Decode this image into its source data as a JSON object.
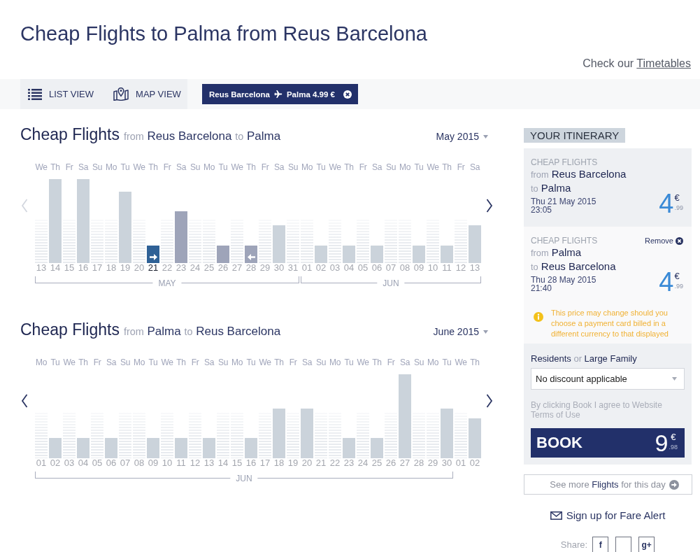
{
  "page": {
    "title": "Cheap Flights to Palma from Reus Barcelona",
    "timetables": {
      "prefix": "Check our",
      "link": "Timetables"
    }
  },
  "toolbar": {
    "views": [
      {
        "kind": "list",
        "label": "LIST VIEW"
      },
      {
        "kind": "map",
        "label": "MAP VIEW"
      }
    ],
    "route_chip": {
      "origin": "Reus Barcelona",
      "destination": "Palma",
      "price": "4.99 €"
    }
  },
  "charts": [
    {
      "title": "Cheap Flights",
      "route": "*from* Reus Barcelona *to* Palma",
      "month_select": "May 2015",
      "prev_arrow": {
        "disabled": true
      },
      "next_arrow": {
        "disabled": false
      },
      "months": [
        {
          "label": "MAY",
          "days": [
            {
              "weekday": "We",
              "date": "13",
              "kind": "empty",
              "selected": false
            },
            {
              "weekday": "Th",
              "date": "14",
              "kind": "fare",
              "selected": false
            },
            {
              "weekday": "Fr",
              "date": "15",
              "kind": "empty",
              "selected": false
            },
            {
              "weekday": "Sa",
              "date": "16",
              "kind": "fare",
              "selected": false
            },
            {
              "weekday": "Su",
              "date": "17",
              "kind": "empty",
              "selected": false
            },
            {
              "weekday": "Mo",
              "date": "18",
              "kind": "empty",
              "selected": false
            },
            {
              "weekday": "Tu",
              "date": "19",
              "kind": "fare",
              "selected": false
            },
            {
              "weekday": "We",
              "date": "20",
              "kind": "empty",
              "selected": false
            },
            {
              "weekday": "Th",
              "date": "21",
              "kind": "outbound",
              "selected": true
            },
            {
              "weekday": "Fr",
              "date": "22",
              "kind": "empty",
              "selected": false
            },
            {
              "weekday": "Sa",
              "date": "23",
              "kind": "in_range",
              "selected": false
            },
            {
              "weekday": "Su",
              "date": "24",
              "kind": "empty",
              "selected": false
            },
            {
              "weekday": "Mo",
              "date": "25",
              "kind": "empty",
              "selected": false
            },
            {
              "weekday": "Tu",
              "date": "26",
              "kind": "in_range",
              "selected": false
            },
            {
              "weekday": "We",
              "date": "27",
              "kind": "empty",
              "selected": false
            },
            {
              "weekday": "Th",
              "date": "28",
              "kind": "return",
              "selected": false
            },
            {
              "weekday": "Fr",
              "date": "29",
              "kind": "empty",
              "selected": false
            },
            {
              "weekday": "Sa",
              "date": "30",
              "kind": "fare",
              "selected": false
            },
            {
              "weekday": "Su",
              "date": "31",
              "kind": "empty",
              "selected": false
            }
          ]
        },
        {
          "label": "JUN",
          "days": [
            {
              "weekday": "Mo",
              "date": "01",
              "kind": "empty",
              "selected": false
            },
            {
              "weekday": "Tu",
              "date": "02",
              "kind": "fare",
              "selected": false
            },
            {
              "weekday": "We",
              "date": "03",
              "kind": "empty",
              "selected": false
            },
            {
              "weekday": "Th",
              "date": "04",
              "kind": "fare",
              "selected": false
            },
            {
              "weekday": "Fr",
              "date": "05",
              "kind": "empty",
              "selected": false
            },
            {
              "weekday": "Sa",
              "date": "06",
              "kind": "fare",
              "selected": false
            },
            {
              "weekday": "Su",
              "date": "07",
              "kind": "empty",
              "selected": false
            },
            {
              "weekday": "Mo",
              "date": "08",
              "kind": "empty",
              "selected": false
            },
            {
              "weekday": "Tu",
              "date": "09",
              "kind": "fare",
              "selected": false
            },
            {
              "weekday": "We",
              "date": "10",
              "kind": "empty",
              "selected": false
            },
            {
              "weekday": "Th",
              "date": "11",
              "kind": "fare",
              "selected": false
            },
            {
              "weekday": "Fr",
              "date": "12",
              "kind": "empty",
              "selected": false
            },
            {
              "weekday": "Sa",
              "date": "13",
              "kind": "fare",
              "selected": false
            }
          ]
        }
      ]
    },
    {
      "title": "Cheap Flights",
      "route": "*from* Palma *to* Reus Barcelona",
      "month_select": "June 2015",
      "prev_arrow": {
        "disabled": false
      },
      "next_arrow": {
        "disabled": false
      },
      "months": [
        {
          "label": "JUN",
          "days": [
            {
              "weekday": "Mo",
              "date": "01",
              "kind": "empty",
              "selected": false
            },
            {
              "weekday": "Tu",
              "date": "02",
              "kind": "fare",
              "selected": false
            },
            {
              "weekday": "We",
              "date": "03",
              "kind": "empty",
              "selected": false
            },
            {
              "weekday": "Th",
              "date": "04",
              "kind": "fare",
              "selected": false
            },
            {
              "weekday": "Fr",
              "date": "05",
              "kind": "empty",
              "selected": false
            },
            {
              "weekday": "Sa",
              "date": "06",
              "kind": "fare",
              "selected": false
            },
            {
              "weekday": "Su",
              "date": "07",
              "kind": "empty",
              "selected": false
            },
            {
              "weekday": "Mo",
              "date": "08",
              "kind": "empty",
              "selected": false
            },
            {
              "weekday": "Tu",
              "date": "09",
              "kind": "fare",
              "selected": false
            },
            {
              "weekday": "We",
              "date": "10",
              "kind": "empty",
              "selected": false
            },
            {
              "weekday": "Th",
              "date": "11",
              "kind": "fare",
              "selected": false
            },
            {
              "weekday": "Fr",
              "date": "12",
              "kind": "empty",
              "selected": false
            },
            {
              "weekday": "Sa",
              "date": "13",
              "kind": "fare",
              "selected": false
            },
            {
              "weekday": "Su",
              "date": "14",
              "kind": "empty",
              "selected": false
            },
            {
              "weekday": "Mo",
              "date": "15",
              "kind": "empty",
              "selected": false
            },
            {
              "weekday": "Tu",
              "date": "16",
              "kind": "fare",
              "selected": false
            },
            {
              "weekday": "We",
              "date": "17",
              "kind": "empty",
              "selected": false
            },
            {
              "weekday": "Th",
              "date": "18",
              "kind": "fare",
              "selected": false
            },
            {
              "weekday": "Fr",
              "date": "19",
              "kind": "empty",
              "selected": false
            },
            {
              "weekday": "Sa",
              "date": "20",
              "kind": "fare",
              "selected": false
            },
            {
              "weekday": "Su",
              "date": "21",
              "kind": "empty",
              "selected": false
            },
            {
              "weekday": "Mo",
              "date": "22",
              "kind": "empty",
              "selected": false
            },
            {
              "weekday": "Tu",
              "date": "23",
              "kind": "fare",
              "selected": false
            },
            {
              "weekday": "We",
              "date": "24",
              "kind": "empty",
              "selected": false
            },
            {
              "weekday": "Th",
              "date": "25",
              "kind": "fare",
              "selected": false
            },
            {
              "weekday": "Fr",
              "date": "26",
              "kind": "empty",
              "selected": false
            },
            {
              "weekday": "Sa",
              "date": "27",
              "kind": "fare",
              "selected": false
            },
            {
              "weekday": "Su",
              "date": "28",
              "kind": "empty",
              "selected": false
            },
            {
              "weekday": "Mo",
              "date": "29",
              "kind": "empty",
              "selected": false
            },
            {
              "weekday": "Tu",
              "date": "30",
              "kind": "fare",
              "selected": false
            }
          ]
        },
        {
          "days": [
            {
              "weekday": "We",
              "date": "01",
              "kind": "empty",
              "selected": false
            },
            {
              "weekday": "Th",
              "date": "02",
              "kind": "fare",
              "selected": false
            }
          ]
        }
      ]
    }
  ],
  "itinerary": {
    "heading": "YOUR ITINERARY",
    "flights": [
      {
        "label": "CHEAP FLIGHTS",
        "from": "*from* Reus Barcelona",
        "to": "*to* Palma",
        "date": "Thu 21 May 2015",
        "time": "23:05",
        "price": {
          "whole": "4",
          "currency": "€",
          "cents": ".99"
        }
      },
      {
        "label": "CHEAP FLIGHTS",
        "remove": "Remove",
        "from": "*from* Palma",
        "to": "*to* Reus Barcelona",
        "date": "Thu 28 May 2015",
        "time": "21:40",
        "price": {
          "whole": "4",
          "currency": "€",
          "cents": ".99"
        }
      }
    ],
    "notice": "This price may change should you choose a payment card billed in a different currency to that displayed",
    "discount": {
      "label": "Residents *or* Large Family",
      "value": "No discount applicable"
    },
    "terms": "By clicking Book I agree to Website Terms of Use",
    "book": {
      "label": "BOOK",
      "price": {
        "whole": "9",
        "currency": "€",
        "cents": ".98"
      }
    }
  },
  "see_more": "See more **Flights** for this day",
  "fare_alert": "Sign up for Fare Alert",
  "share": {
    "label": "Share:",
    "buttons": [
      {
        "kind": "glyph",
        "glyph": "f"
      },
      {
        "kind": "blank"
      },
      {
        "kind": "glyph",
        "glyph": "g+"
      }
    ]
  }
}
